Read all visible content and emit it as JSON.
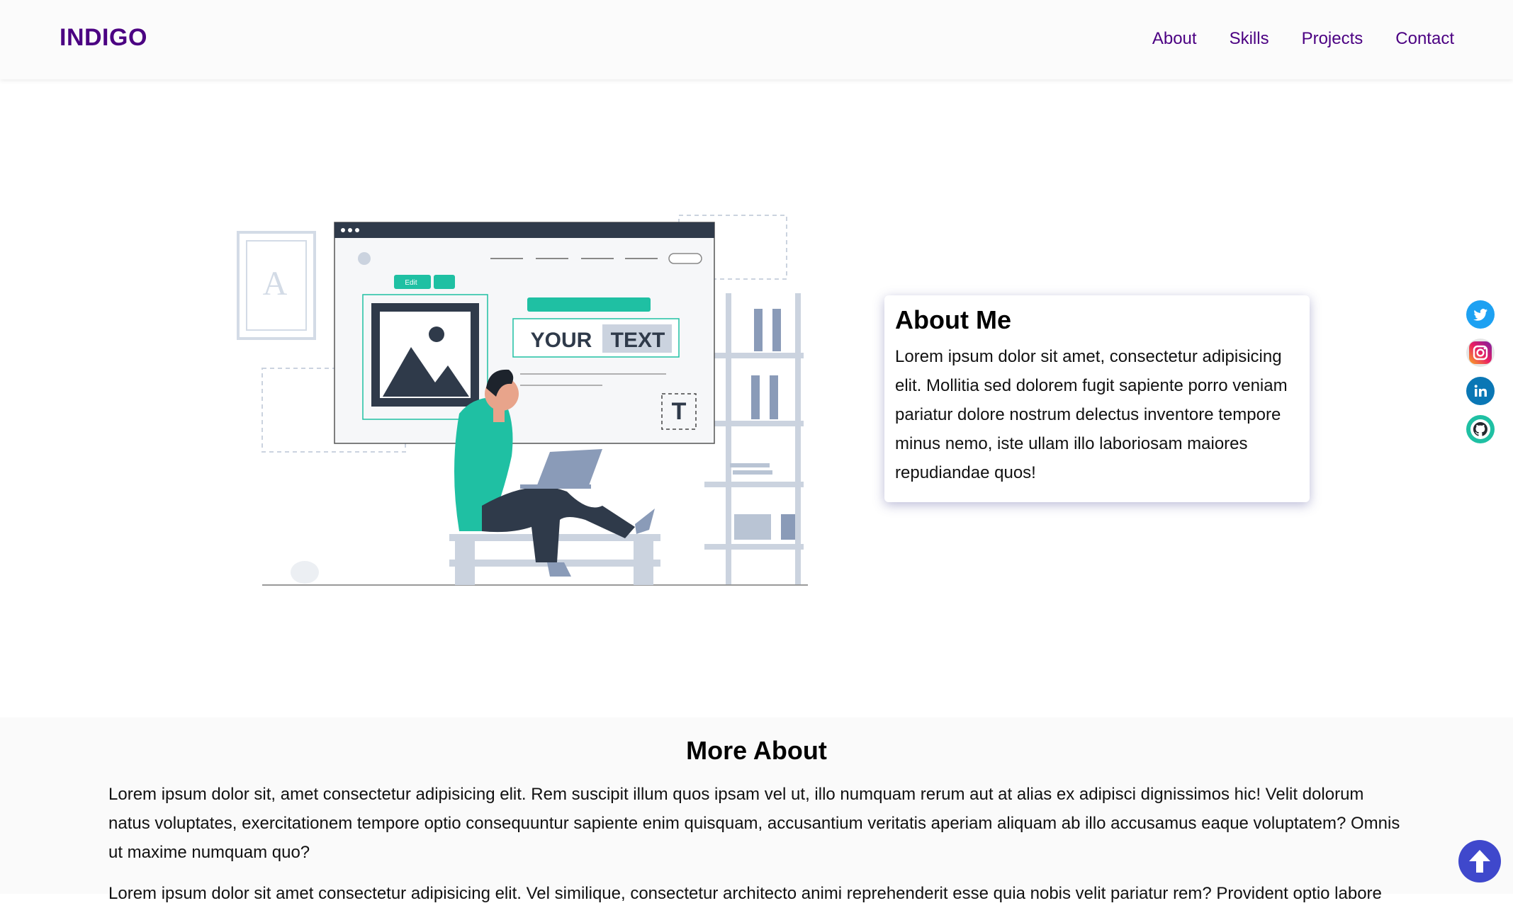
{
  "nav": {
    "brand": "INDIGO",
    "links": [
      "About",
      "Skills",
      "Projects",
      "Contact"
    ]
  },
  "illustration": {
    "edit_label": "Edit",
    "your_label": "YOUR",
    "text_label": "TEXT",
    "letter_a": "A",
    "letter_t": "T"
  },
  "about": {
    "title": "About Me",
    "body": "Lorem ipsum dolor sit amet, consectetur adipisicing elit. Mollitia sed dolorem fugit sapiente porro veniam pariatur dolore nostrum delectus inventore tempore minus nemo, iste ullam illo laboriosam maiores repudiandae quos!"
  },
  "social": [
    "twitter-icon",
    "instagram-icon",
    "linkedin-icon",
    "github-icon"
  ],
  "more_about": {
    "title": "More About",
    "p1": "Lorem ipsum dolor sit, amet consectetur adipisicing elit. Rem suscipit illum quos ipsam vel ut, illo numquam rerum aut at alias ex adipisci dignissimos hic! Velit dolorum natus voluptates, exercitationem tempore optio consequuntur sapiente enim quisquam, accusantium veritatis aperiam aliquam ab illo accusamus eaque voluptatem? Omnis ut maxime numquam quo?",
    "p2": "Lorem ipsum dolor sit amet consectetur adipisicing elit. Vel similique, consectetur architecto animi reprehenderit esse quia nobis velit pariatur rem? Provident optio labore"
  },
  "colors": {
    "brand": "#4b0082",
    "accent": "#1fc0a3",
    "to_top": "#3f48cc"
  }
}
